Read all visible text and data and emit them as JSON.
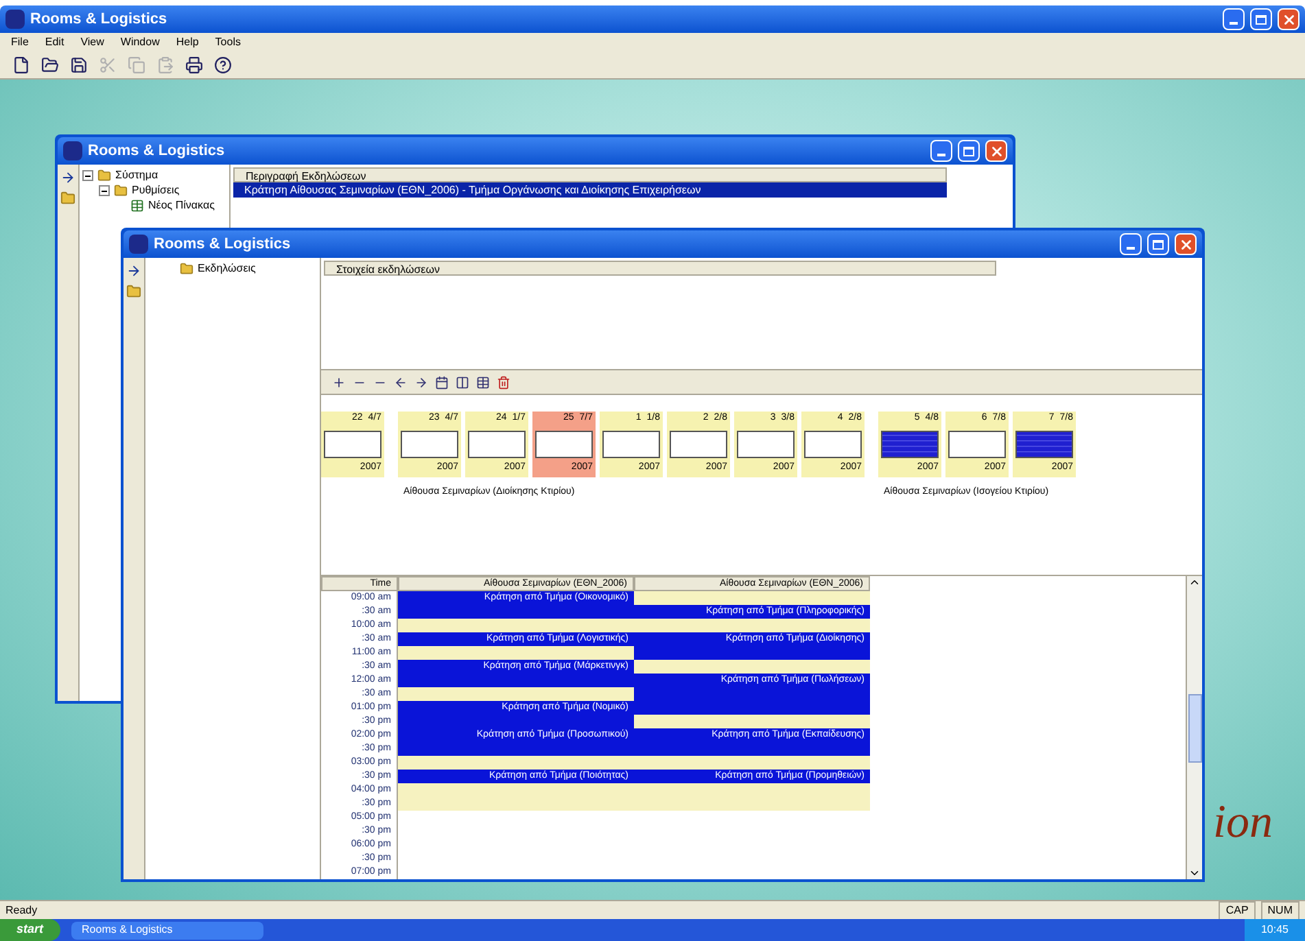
{
  "window": {
    "title": "Rooms & Logistics"
  },
  "menu": [
    "File",
    "Edit",
    "View",
    "Window",
    "Help",
    "Tools"
  ],
  "toolbar": [
    {
      "kind": "new",
      "disabled": false
    },
    {
      "kind": "open",
      "disabled": false
    },
    {
      "kind": "save",
      "disabled": false
    },
    {
      "kind": "cut",
      "disabled": true
    },
    {
      "kind": "copy",
      "disabled": true
    },
    {
      "kind": "paste",
      "disabled": true
    },
    {
      "kind": "print",
      "disabled": false
    },
    {
      "kind": "help",
      "disabled": false
    }
  ],
  "back_window": {
    "title": "Rooms & Logistics",
    "tree": [
      {
        "label": "Σύστημα",
        "expanded": true,
        "children": [
          {
            "label": "Ρυθμίσεις",
            "expanded": true,
            "children": [
              {
                "label": "Νέος Πίνακας"
              }
            ]
          }
        ]
      }
    ],
    "list_header": "Περιγραφή Εκδηλώσεων",
    "rows": [
      {
        "text": "Κράτηση Αίθουσας Σεμιναρίων (ΕΘΝ_2006) - Τμήμα Οργάνωσης και Διοίκησης Επιχειρήσεων",
        "selected": true
      }
    ]
  },
  "front_window": {
    "title": "Rooms & Logistics",
    "tree": [
      {
        "label": "Εκδηλώσεις"
      }
    ],
    "list_header": "Στοιχεία εκδηλώσεων",
    "room_groups": [
      {
        "cells": [
          {
            "day": "22",
            "count": "4/7",
            "total": "2007",
            "kind": "empty"
          }
        ]
      },
      {
        "caption": "Αίθουσα Σεμιναρίων (Διοίκησης Κτιρίου)",
        "cells": [
          {
            "day": "23",
            "count": "4/7",
            "total": "2007",
            "kind": "empty"
          },
          {
            "day": "24",
            "count": "1/7",
            "total": "2007",
            "kind": "empty"
          },
          {
            "day": "25",
            "count": "7/7",
            "total": "2007",
            "kind": "selected"
          },
          {
            "day": "1",
            "count": "1/8",
            "total": "2007",
            "kind": "empty"
          },
          {
            "day": "2",
            "count": "2/8",
            "total": "2007",
            "kind": "empty"
          },
          {
            "day": "3",
            "count": "3/8",
            "total": "2007",
            "kind": "empty"
          },
          {
            "day": "4",
            "count": "2/8",
            "total": "2007",
            "kind": "empty"
          }
        ]
      },
      {
        "caption": "Αίθουσα Σεμιναρίων (Ισογείου Κτιρίου)",
        "cells": [
          {
            "day": "5",
            "count": "4/8",
            "total": "2007",
            "kind": "booked"
          },
          {
            "day": "6",
            "count": "7/8",
            "total": "2007",
            "kind": "empty"
          },
          {
            "day": "7",
            "count": "7/8",
            "total": "2007",
            "kind": "booked"
          }
        ]
      }
    ],
    "schedule": {
      "time_header": "Time",
      "columns": [
        "Αίθουσα Σεμιναρίων (ΕΘΝ_2006)",
        "Αίθουσα Σεμιναρίων (ΕΘΝ_2006)"
      ],
      "rows": [
        {
          "time": "09:00 am",
          "cells": [
            {
              "kind": "booked",
              "label": "Κράτηση από Τμήμα (Οικονομικό)"
            },
            {
              "kind": "free"
            }
          ]
        },
        {
          "time": ":30 am",
          "cells": [
            {
              "kind": "booked"
            },
            {
              "kind": "booked",
              "label": "Κράτηση από Τμήμα (Πληροφορικής)"
            }
          ]
        },
        {
          "time": "10:00 am",
          "cells": [
            {
              "kind": "free"
            },
            {
              "kind": "free"
            }
          ]
        },
        {
          "time": ":30 am",
          "cells": [
            {
              "kind": "booked",
              "label": "Κράτηση από Τμήμα (Λογιστικής)"
            },
            {
              "kind": "booked",
              "label": "Κράτηση από Τμήμα (Διοίκησης)"
            }
          ]
        },
        {
          "time": "11:00 am",
          "cells": [
            {
              "kind": "free"
            },
            {
              "kind": "booked"
            }
          ]
        },
        {
          "time": ":30 am",
          "cells": [
            {
              "kind": "booked",
              "label": "Κράτηση από Τμήμα (Μάρκετινγκ)"
            },
            {
              "kind": "free"
            }
          ]
        },
        {
          "time": "12:00 am",
          "cells": [
            {
              "kind": "booked"
            },
            {
              "kind": "booked",
              "label": "Κράτηση από Τμήμα (Πωλήσεων)"
            }
          ]
        },
        {
          "time": ":30 am",
          "cells": [
            {
              "kind": "free"
            },
            {
              "kind": "booked"
            }
          ]
        },
        {
          "time": "01:00 pm",
          "cells": [
            {
              "kind": "booked",
              "label": "Κράτηση από Τμήμα (Νομικό)"
            },
            {
              "kind": "booked"
            }
          ]
        },
        {
          "time": ":30 pm",
          "cells": [
            {
              "kind": "booked"
            },
            {
              "kind": "free"
            }
          ]
        },
        {
          "time": "02:00 pm",
          "cells": [
            {
              "kind": "booked",
              "label": "Κράτηση από Τμήμα (Προσωπικού)"
            },
            {
              "kind": "booked",
              "label": "Κράτηση από Τμήμα (Εκπαίδευσης)"
            }
          ]
        },
        {
          "time": ":30 pm",
          "cells": [
            {
              "kind": "booked"
            },
            {
              "kind": "booked"
            }
          ]
        },
        {
          "time": "03:00 pm",
          "cells": [
            {
              "kind": "free"
            },
            {
              "kind": "free"
            }
          ]
        },
        {
          "time": ":30 pm",
          "cells": [
            {
              "kind": "booked",
              "label": "Κράτηση από Τμήμα (Ποιότητας)"
            },
            {
              "kind": "booked",
              "label": "Κράτηση από Τμήμα (Προμηθειών)"
            }
          ]
        },
        {
          "time": "04:00 pm",
          "cells": [
            {
              "kind": "free"
            },
            {
              "kind": "free"
            }
          ]
        },
        {
          "time": ":30 pm",
          "cells": [
            {
              "kind": "free"
            },
            {
              "kind": "free"
            }
          ]
        },
        {
          "time": "05:00 pm"
        },
        {
          "time": ":30 pm"
        },
        {
          "time": "06:00 pm"
        },
        {
          "time": ":30 pm"
        },
        {
          "time": "07:00 pm"
        }
      ]
    }
  },
  "wallpaper_text": "ion",
  "status_bar": {
    "text": "Ready",
    "indicators": [
      "CAP",
      "NUM"
    ]
  },
  "taskbar": {
    "start": "start",
    "tasks": [
      "Rooms & Logistics"
    ],
    "clock": "10:45"
  }
}
